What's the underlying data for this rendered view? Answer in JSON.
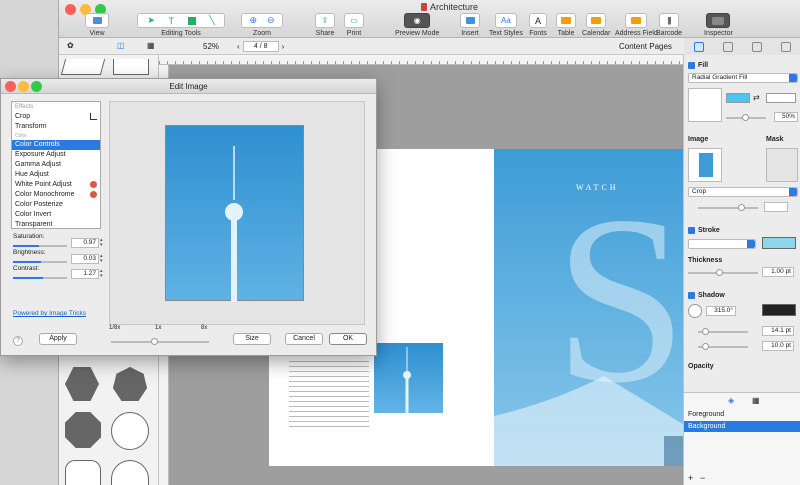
{
  "window": {
    "title": "Architecture"
  },
  "toolbar": {
    "view": "View",
    "editing_tools": "Editing Tools",
    "zoom": "Zoom",
    "share": "Share",
    "print": "Print",
    "preview_mode": "Preview Mode",
    "insert": "Insert",
    "text_styles": "Text Styles",
    "fonts": "Fonts",
    "table": "Table",
    "calendar": "Calendar",
    "address_field": "Address Field",
    "barcode": "Barcode",
    "inspector": "Inspector"
  },
  "subbar": {
    "zoom_value": "52%",
    "page_indicator": "4 / 8",
    "content_pages": "Content Pages"
  },
  "page": {
    "watch_text": "WATCH",
    "big_letter": "S"
  },
  "inspector": {
    "fill_label": "Fill",
    "fill_type": "Radial Gradient Fill",
    "fill_percent": "50%",
    "image_label": "Image",
    "mask_label": "Mask",
    "crop_select": "Crop",
    "stroke_label": "Stroke",
    "thickness_label": "Thickness",
    "thickness_value": "1.00 pt",
    "shadow_label": "Shadow",
    "shadow_angle": "315.0°",
    "shadow_val1": "14.1 pt",
    "shadow_val2": "10.0 pt",
    "opacity_label": "Opacity",
    "layers": [
      "Foreground",
      "Background"
    ]
  },
  "dialog": {
    "title": "Edit Image",
    "effects_header": "Effects",
    "effects": [
      "Crop",
      "Transform"
    ],
    "category": "Color",
    "color_effects": [
      "Color Controls",
      "Exposure Adjust",
      "Gamma Adjust",
      "Hue Adjust",
      "White Point Adjust",
      "Color Monochrome",
      "Color Posterize",
      "Color Invert",
      "Transparent"
    ],
    "saturation_label": "Saturation:",
    "saturation_value": "0.97",
    "saturation_level": 0.48,
    "brightness_label": "Brightness:",
    "brightness_value": "0.03",
    "brightness_level": 0.52,
    "contrast_label": "Contrast:",
    "contrast_value": "1.27",
    "contrast_level": 0.55,
    "powered_by": "Powered by Image Tricks",
    "apply": "Apply",
    "zoom_min": "1/8x",
    "zoom_mid": "1x",
    "zoom_max": "8x",
    "size": "Size",
    "cancel": "Cancel",
    "ok": "OK",
    "help": "?"
  }
}
